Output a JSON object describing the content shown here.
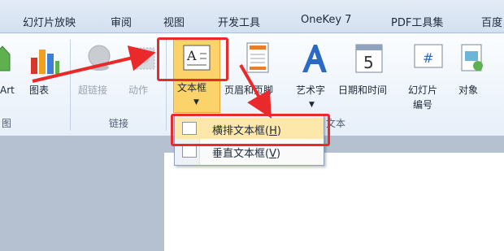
{
  "tabs": [
    "幻灯片放映",
    "审阅",
    "视图",
    "开发工具",
    "OneKey 7",
    "PDF工具集",
    "百度"
  ],
  "ribbon": {
    "buttons": [
      {
        "label": "Art",
        "icon": "smartart-icon"
      },
      {
        "label": "图表",
        "icon": "chart-icon"
      },
      {
        "label": "超链接",
        "icon": "hyperlink-icon"
      },
      {
        "label": "动作",
        "icon": "action-icon"
      },
      {
        "label": "文本框",
        "icon": "textbox-icon"
      },
      {
        "label": "页眉和页脚",
        "icon": "header-footer-icon"
      },
      {
        "label": "艺术字",
        "icon": "wordart-icon"
      },
      {
        "label": "日期和时间",
        "icon": "date-time-icon"
      },
      {
        "label": "幻灯片",
        "label2": "编号",
        "icon": "slide-number-icon"
      },
      {
        "label": "对象",
        "icon": "object-icon"
      }
    ],
    "group_labels": [
      "图",
      "链接",
      "文本"
    ],
    "date_icon_digit": "5",
    "slide_number_symbol": "#",
    "textbox_icon_letter": "A"
  },
  "dropdown": {
    "items": [
      {
        "label": "横排文本框",
        "shortcut": "H"
      },
      {
        "label": "垂直文本框",
        "shortcut": "V"
      }
    ]
  },
  "colors": {
    "annotation_red": "#ea2a2a",
    "hover_orange": "#fbd36a"
  }
}
